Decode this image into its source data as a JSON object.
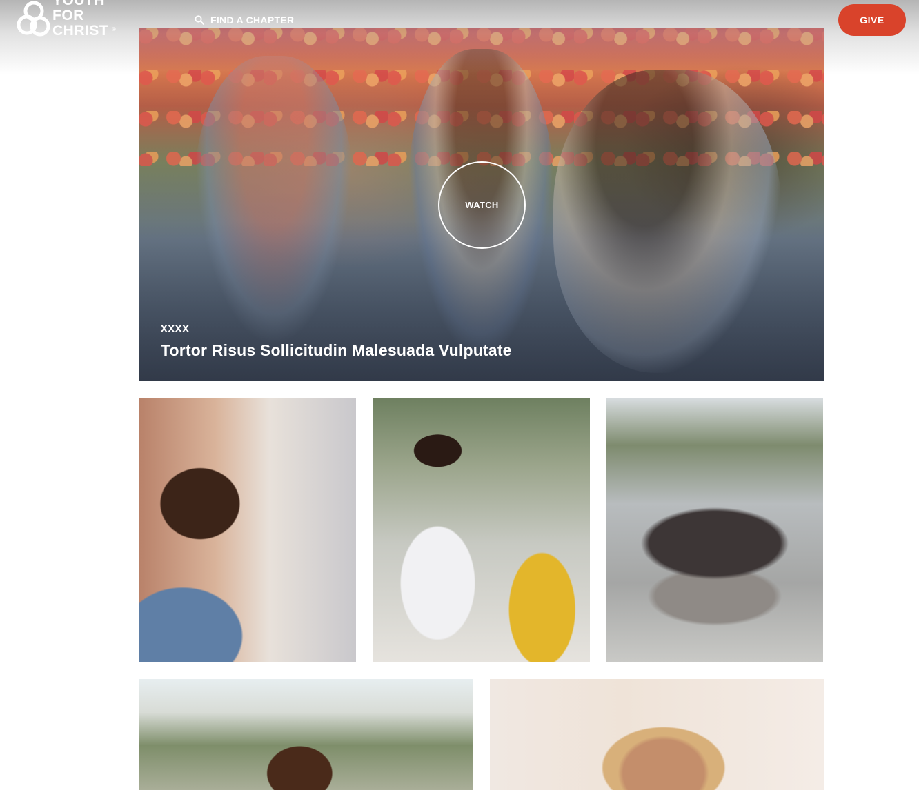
{
  "header": {
    "logo_alt": "Youth for Christ",
    "logo_lines": [
      "YOUTH",
      "FOR",
      "CHRIST"
    ],
    "find_chapter_label": "FIND A CHAPTER",
    "give_label": "GIVE"
  },
  "hero": {
    "watch_label": "WATCH",
    "kicker": "xxxx",
    "title": "Tortor Risus Sollicitudin Malesuada Vulputate"
  },
  "colors": {
    "give_button": "#d9432b",
    "text_on_image": "#ffffff"
  },
  "icons": {
    "search": "search-icon",
    "logo": "ring-logo-icon"
  }
}
